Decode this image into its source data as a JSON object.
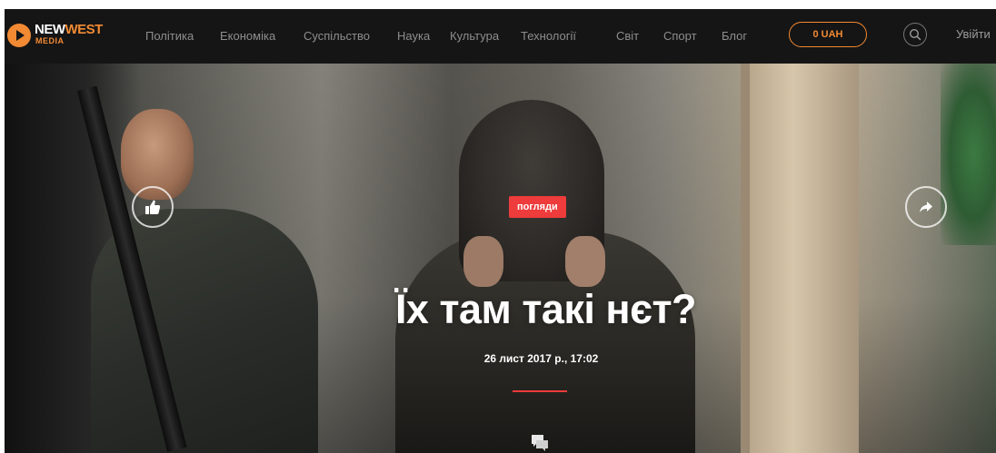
{
  "brand": {
    "name_part1": "NEW",
    "name_part2": "WEST",
    "sub": "MEDIA"
  },
  "nav": {
    "items": [
      "Політика",
      "Економіка",
      "Суспільство",
      "Наука",
      "Культура",
      "Технології",
      "Світ",
      "Спорт",
      "Блог"
    ]
  },
  "header": {
    "wallet_label": "0 UAH",
    "login_label": "Увійти",
    "search_icon": "search-icon"
  },
  "article": {
    "category": "погляди",
    "title": "Їх там такі нєт?",
    "date": "26 лист 2017 р., 17:02"
  },
  "icons": {
    "like": "thumbs-up-icon",
    "share": "share-arrow-icon",
    "comments": "comments-icon"
  },
  "colors": {
    "accent_orange": "#f28a33",
    "badge_red": "#ee3b3b",
    "header_bg": "#151515"
  }
}
